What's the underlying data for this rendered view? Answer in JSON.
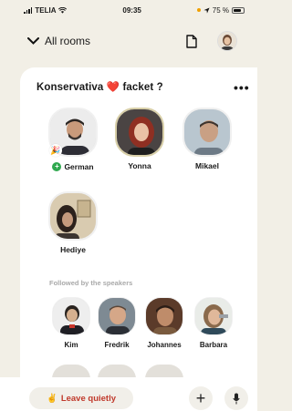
{
  "status": {
    "carrier": "TELIA",
    "time": "09:35",
    "battery": "75 %"
  },
  "nav": {
    "back_label": "All rooms"
  },
  "room": {
    "title": "Konservativa ❤️ facket ?",
    "more": "•••",
    "speakers": [
      {
        "name": "German",
        "moderator": true,
        "badge": "+",
        "reaction": "🎉"
      },
      {
        "name": "Yonna",
        "speaking": true
      },
      {
        "name": "Mikael"
      },
      {
        "name": "Hediye"
      }
    ],
    "followed_label": "Followed by the speakers",
    "listeners": [
      {
        "name": "Kim"
      },
      {
        "name": "Fredrik"
      },
      {
        "name": "Johannes"
      },
      {
        "name": "Barbara"
      }
    ]
  },
  "actions": {
    "leave_label": "Leave quietly",
    "leave_emoji": "✌️",
    "plus": "+"
  },
  "colors": {
    "background": "#f2efe6",
    "sheet": "#ffffff",
    "leave_text": "#c0392b",
    "moderator_badge": "#2fa84f"
  }
}
